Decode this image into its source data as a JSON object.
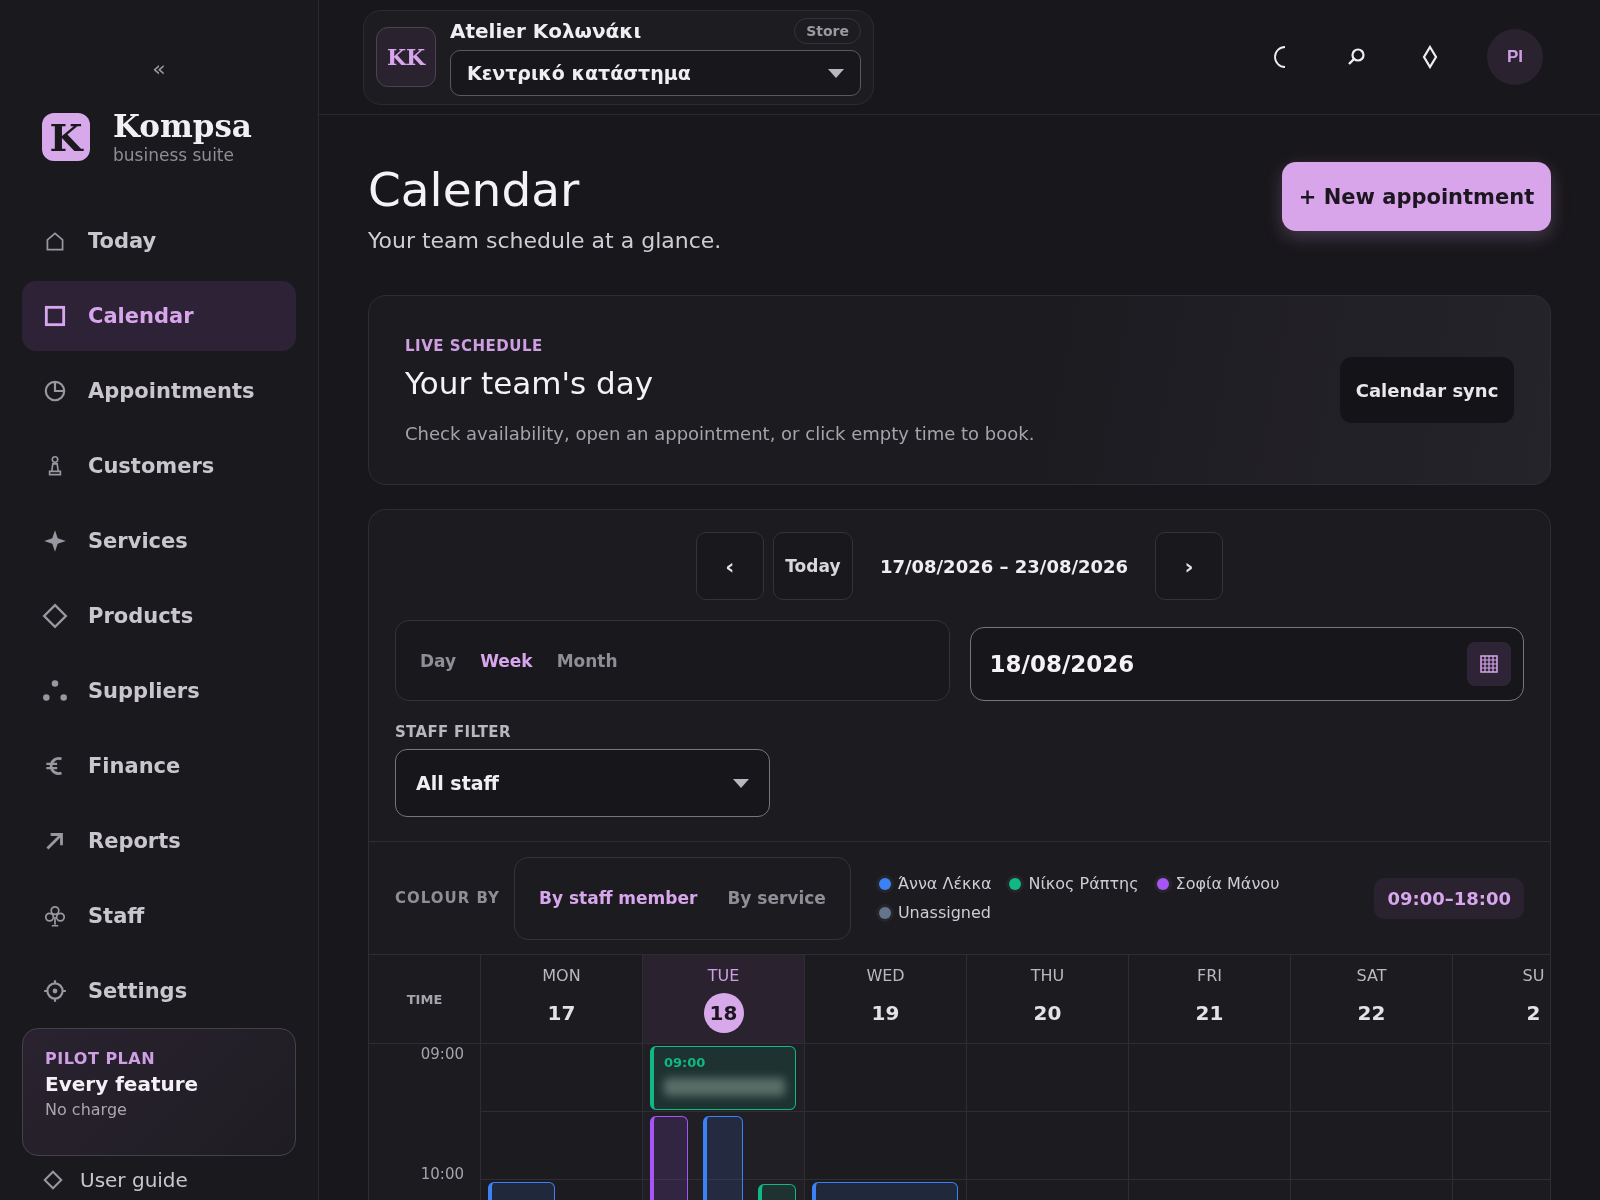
{
  "sidebar": {
    "collapse": "«",
    "logo_mark": "K",
    "brand": "Kompsa",
    "tagline": "business suite",
    "nav": [
      {
        "label": "Today",
        "kind": "home",
        "selected": false
      },
      {
        "label": "Calendar",
        "kind": "square",
        "selected": true
      },
      {
        "label": "Appointments",
        "kind": "clock",
        "selected": false
      },
      {
        "label": "Customers",
        "kind": "pawn",
        "selected": false
      },
      {
        "label": "Services",
        "kind": "sparkle",
        "selected": false
      },
      {
        "label": "Products",
        "kind": "diamond",
        "selected": false
      },
      {
        "label": "Suppliers",
        "kind": "dots",
        "selected": false
      },
      {
        "label": "Finance",
        "kind": "euro",
        "selected": false
      },
      {
        "label": "Reports",
        "kind": "arrow",
        "selected": false
      },
      {
        "label": "Staff",
        "kind": "club",
        "selected": false
      },
      {
        "label": "Settings",
        "kind": "gear",
        "selected": false
      }
    ],
    "plan": {
      "eyebrow": "PILOT PLAN",
      "title": "Every feature",
      "note": "No charge"
    },
    "footer_link": "User guide"
  },
  "topbar": {
    "store_initials": "KK",
    "store_name": "Atelier Κολωνάκι",
    "store_badge": "Store",
    "location": "Κεντρικό κατάστημα",
    "avatar": "PI"
  },
  "header": {
    "title": "Calendar",
    "subtitle": "Your team schedule at a glance.",
    "primary_action": "+ New appointment"
  },
  "live": {
    "eyebrow": "LIVE SCHEDULE",
    "title": "Your team's day",
    "description": "Check availability, open an appointment, or click empty time to book.",
    "action": "Calendar sync"
  },
  "calendar": {
    "prev": "‹",
    "today": "Today",
    "range": "17/08/2026 – 23/08/2026",
    "next": "›",
    "views": [
      {
        "label": "Day",
        "selected": false
      },
      {
        "label": "Week",
        "selected": true
      },
      {
        "label": "Month",
        "selected": false
      }
    ],
    "date_value": "18/08/2026",
    "staff_filter": {
      "label": "STAFF FILTER",
      "value": "All staff"
    },
    "colour_by": {
      "label": "COLOUR BY",
      "options": [
        {
          "label": "By staff member",
          "selected": true
        },
        {
          "label": "By service",
          "selected": false
        }
      ]
    },
    "legend": [
      {
        "name": "Άννα Λέκκα",
        "color": "#3b82f6"
      },
      {
        "name": "Νίκος Ράπτης",
        "color": "#10b981"
      },
      {
        "name": "Σοφία Μάνου",
        "color": "#a855f7"
      },
      {
        "name": "Unassigned",
        "color": "#64748b"
      }
    ],
    "hours": "09:00–18:00",
    "time_header": "TIME",
    "time_labels": [
      "09:00",
      "10:00"
    ],
    "days": [
      {
        "weekday": "MON",
        "date": "17",
        "selected": false,
        "events": [
          {
            "color": "#3b82f6"
          }
        ]
      },
      {
        "weekday": "TUE",
        "date": "18",
        "selected": true,
        "events": [
          {
            "color": "#10b981",
            "time": "09:00"
          },
          {
            "color": "#a855f7"
          },
          {
            "color": "#3b82f6"
          },
          {
            "color": "#10b981"
          }
        ]
      },
      {
        "weekday": "WED",
        "date": "19",
        "selected": false,
        "events": [
          {
            "color": "#3b82f6"
          }
        ]
      },
      {
        "weekday": "THU",
        "date": "20",
        "selected": false
      },
      {
        "weekday": "FRI",
        "date": "21",
        "selected": false
      },
      {
        "weekday": "SAT",
        "date": "22",
        "selected": false
      },
      {
        "weekday": "SU",
        "date": "2",
        "selected": false
      }
    ]
  }
}
